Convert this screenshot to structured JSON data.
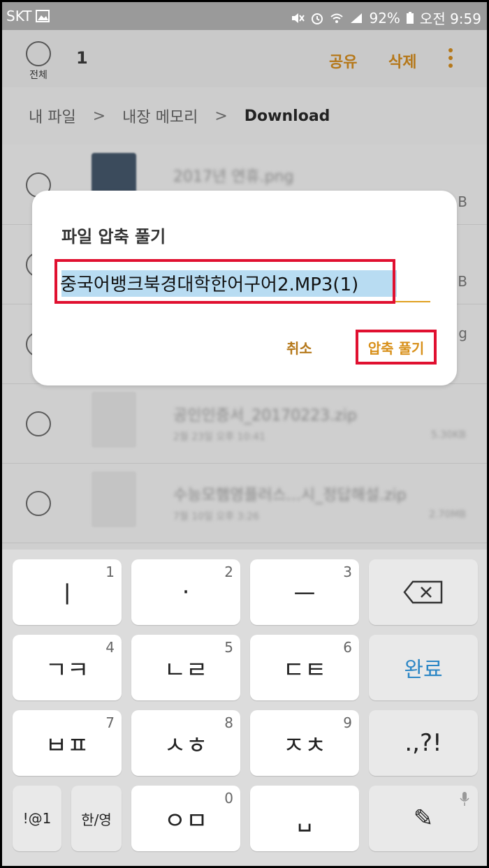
{
  "status_bar": {
    "carrier": "SKT",
    "battery": "92%",
    "time": "오전 9:59"
  },
  "app_bar": {
    "select_all_label": "전체",
    "selected_count": "1",
    "share": "공유",
    "delete": "삭제"
  },
  "breadcrumb": {
    "items": [
      "내 파일",
      "내장 메모리",
      "Download"
    ],
    "separator": ">"
  },
  "file_list": {
    "rows": [
      {
        "name": "2017년 연휴.png",
        "meta": "",
        "size": "",
        "edge": "B"
      },
      {
        "name": "",
        "meta": "",
        "size": "",
        "edge": "B"
      },
      {
        "name": "",
        "meta": "",
        "size": "",
        "edge": "g"
      },
      {
        "name": "공인인증서_20170223.zip",
        "meta": "2월 23일 오후 10:41",
        "size": "5.30KB",
        "edge": ""
      },
      {
        "name": "수능모햄영플러스...시_정답해설.zip",
        "meta": "7월 10일 오후 3:26",
        "size": "2.70MB",
        "edge": ""
      }
    ]
  },
  "dialog": {
    "title": "파일 압축 풀기",
    "filename": "중국어뱅크북경대학한어구어2.MP3(1)",
    "cancel": "취소",
    "extract": "압축 풀기"
  },
  "keyboard": {
    "rows": [
      [
        {
          "label": "ㅣ",
          "num": "1"
        },
        {
          "label": "·",
          "num": "2"
        },
        {
          "label": "ㅡ",
          "num": "3"
        },
        {
          "label": "⌫",
          "num": ""
        }
      ],
      [
        {
          "label": "ㄱㅋ",
          "num": "4"
        },
        {
          "label": "ㄴㄹ",
          "num": "5"
        },
        {
          "label": "ㄷㅌ",
          "num": "6"
        },
        {
          "label": "완료",
          "num": ""
        }
      ],
      [
        {
          "label": "ㅂㅍ",
          "num": "7"
        },
        {
          "label": "ㅅㅎ",
          "num": "8"
        },
        {
          "label": "ㅈㅊ",
          "num": "9"
        },
        {
          "label": ".,?!",
          "num": ""
        }
      ],
      [
        {
          "label": "!@1",
          "num": ""
        },
        {
          "label": "한/영",
          "num": ""
        },
        {
          "label": "ㅇㅁ",
          "num": "0"
        },
        {
          "label": "␣",
          "num": ""
        },
        {
          "label": "✎",
          "num": ""
        }
      ]
    ]
  },
  "colors": {
    "accent": "#b5781a",
    "highlight_red": "#e01030",
    "done_blue": "#2b86c5"
  }
}
